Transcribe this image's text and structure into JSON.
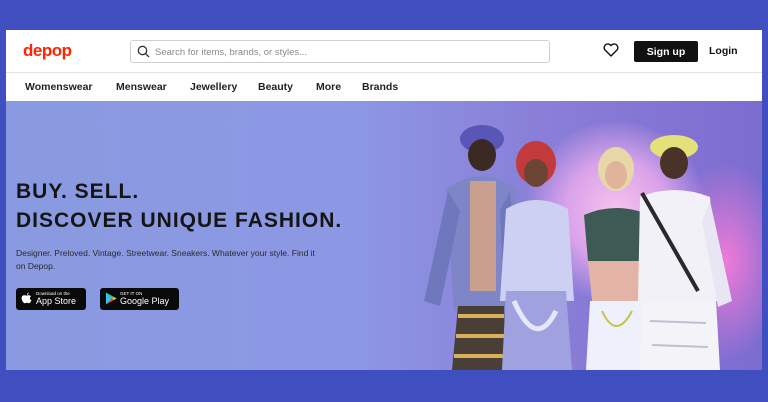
{
  "header": {
    "logo": "depop",
    "search_placeholder": "Search for items, brands, or styles...",
    "signup_label": "Sign up",
    "login_label": "Login"
  },
  "nav": {
    "items": [
      "Womenswear",
      "Menswear",
      "Jewellery",
      "Beauty",
      "More",
      "Brands"
    ]
  },
  "hero": {
    "headline_1": "BUY. SELL.",
    "headline_2": "DISCOVER UNIQUE FASHION.",
    "subtext": "Designer. Preloved. Vintage. Streetwear. Sneakers. Whatever your style. Find it on Depop.",
    "app_store": {
      "small": "Download on the",
      "big": "App Store"
    },
    "google_play": {
      "small": "GET IT ON",
      "big": "Google Play"
    }
  },
  "colors": {
    "brand": "#ff2300",
    "background": "#3f4fc0",
    "hero": "#8a9ae0"
  },
  "icons": [
    "search-icon",
    "heart-icon",
    "apple-icon",
    "google-play-icon"
  ]
}
